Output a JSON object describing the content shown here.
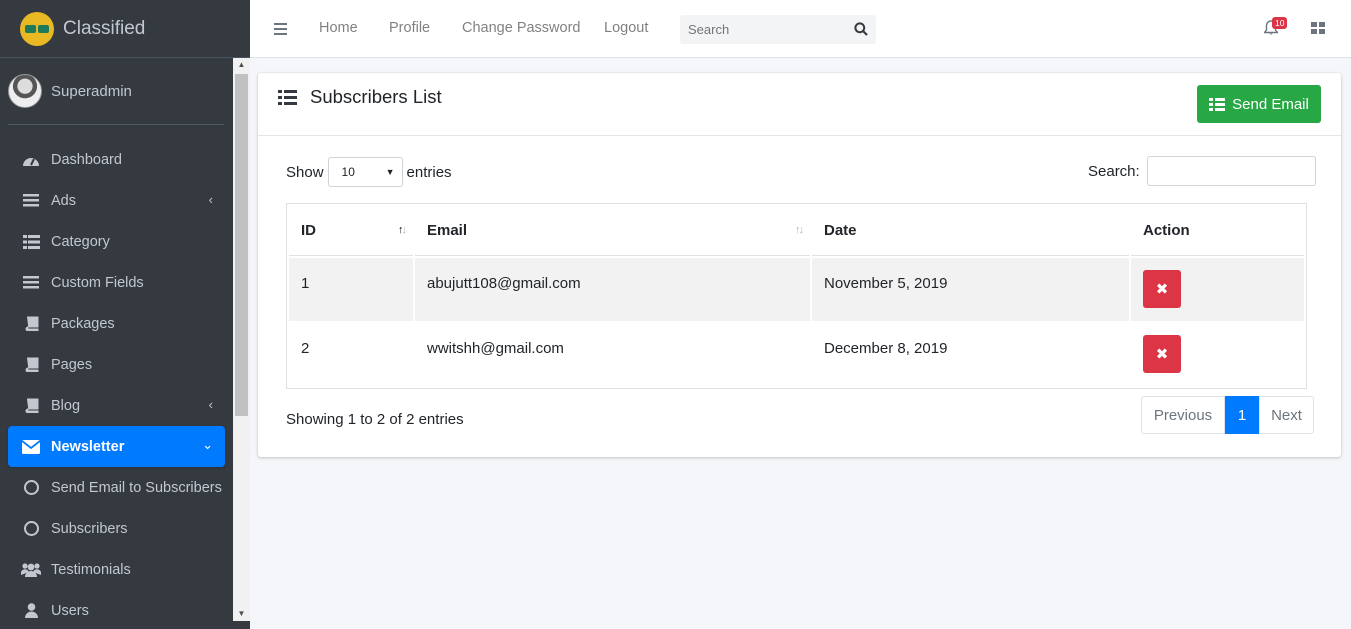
{
  "brand": {
    "title": "Classified"
  },
  "user": {
    "name": "Superadmin"
  },
  "sidebar": {
    "items": [
      {
        "label": "Dashboard",
        "icon": "dashboard-icon"
      },
      {
        "label": "Ads",
        "icon": "bars-icon"
      },
      {
        "label": "Category",
        "icon": "list-icon"
      },
      {
        "label": "Custom Fields",
        "icon": "bars-icon"
      },
      {
        "label": "Packages",
        "icon": "book-icon"
      },
      {
        "label": "Pages",
        "icon": "book-icon"
      },
      {
        "label": "Blog",
        "icon": "book-icon"
      },
      {
        "label": "Newsletter",
        "icon": "envelope-icon"
      },
      {
        "label": "Send Email to Subscribers",
        "icon": "circle-icon"
      },
      {
        "label": "Subscribers",
        "icon": "circle-icon"
      },
      {
        "label": "Testimonials",
        "icon": "users-icon"
      },
      {
        "label": "Users",
        "icon": "user-icon"
      }
    ]
  },
  "topnav": {
    "links": [
      "Home",
      "Profile",
      "Change Password",
      "Logout"
    ],
    "search_placeholder": "Search",
    "notification_count": "10"
  },
  "card": {
    "title": "Subscribers List",
    "send_button": "Send Email",
    "show_label": "Show",
    "entries_value": "10",
    "entries_label": "entries",
    "search_label": "Search:"
  },
  "table": {
    "headers": [
      "ID",
      "Email",
      "Date",
      "Action"
    ],
    "rows": [
      {
        "id": "1",
        "email": "abujutt108@gmail.com",
        "date": "November 5, 2019"
      },
      {
        "id": "2",
        "email": "wwitshh@gmail.com",
        "date": "December 8, 2019"
      }
    ]
  },
  "footer": {
    "info": "Showing 1 to 2 of 2 entries",
    "previous": "Previous",
    "current_page": "1",
    "next": "Next"
  },
  "colors": {
    "sidebar": "#343a40",
    "active": "#007bff",
    "send": "#28a745",
    "delete": "#dc3545"
  }
}
